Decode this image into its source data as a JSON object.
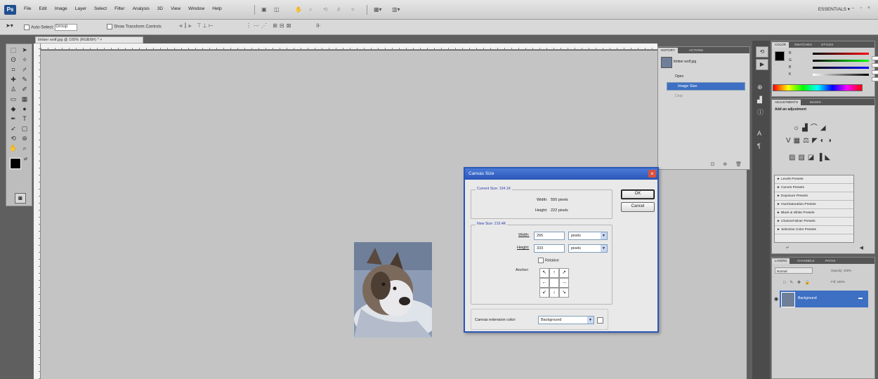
{
  "app": {
    "logo": "Ps",
    "menus": [
      "File",
      "Edit",
      "Image",
      "Layer",
      "Select",
      "Filter",
      "Analysis",
      "3D",
      "View",
      "Window",
      "Help"
    ],
    "workspace": "ESSENTIALS ▾",
    "window_controls": "– ▫ ×"
  },
  "options_bar": {
    "auto_select": "Auto-Select:",
    "auto_select_value": "Group",
    "show_transform": "Show Transform Controls"
  },
  "document": {
    "tab_title": "timber wolf.jpg @ 100% (RGB/8#) * ×"
  },
  "history": {
    "tabs": [
      "HISTORY",
      "ACTIONS"
    ],
    "snapshot": "timber wolf.jpg",
    "items": [
      "Open",
      "Image Size",
      "Crop"
    ]
  },
  "color_panel": {
    "tabs": [
      "COLOR",
      "SWATCHES",
      "STYLES"
    ],
    "channels": [
      {
        "label": "R",
        "value": "0"
      },
      {
        "label": "G",
        "value": "0"
      },
      {
        "label": "B",
        "value": "0"
      },
      {
        "label": "K",
        "value": "0"
      }
    ],
    "unit": "%"
  },
  "adjustments": {
    "tabs": [
      "ADJUSTMENTS",
      "MASKS"
    ],
    "heading": "Add an adjustment",
    "presets": [
      "Levels Presets",
      "Curves Presets",
      "Exposure Presets",
      "Hue/Saturation Presets",
      "Black & White Presets",
      "Channel Mixer Presets",
      "Selective Color Presets"
    ]
  },
  "layers": {
    "tabs": [
      "LAYERS",
      "CHANNELS",
      "PATHS"
    ],
    "blend_mode": "Normal",
    "opacity": "Opacity: 100%",
    "fill": "Fill: 100%",
    "layer_name": "Background"
  },
  "dialog": {
    "title": "Canvas Size",
    "current_size": "Current Size: 104.1K",
    "width_label": "Width:",
    "current_width": "550 pixels",
    "height_label": "Height:",
    "current_height": "222 pixels",
    "new_size": "New Size: 216.4K",
    "new_width_label": "Width:",
    "new_width_value": "265",
    "new_height_label": "Height:",
    "new_height_value": "333",
    "unit": "pixels",
    "relative": "Relative",
    "anchor_label": "Anchor:",
    "anchors": [
      "↖",
      "↑",
      "↗",
      "←",
      "",
      "→",
      "↙",
      "↓",
      "↘"
    ],
    "ok": "OK",
    "cancel": "Cancel",
    "extension_label": "Canvas extension color:",
    "extension_value": "Background"
  },
  "colors": {
    "accent": "#3d6fc3",
    "dialog_border": "#2a56b8",
    "canvas": "#c4c4c4"
  }
}
